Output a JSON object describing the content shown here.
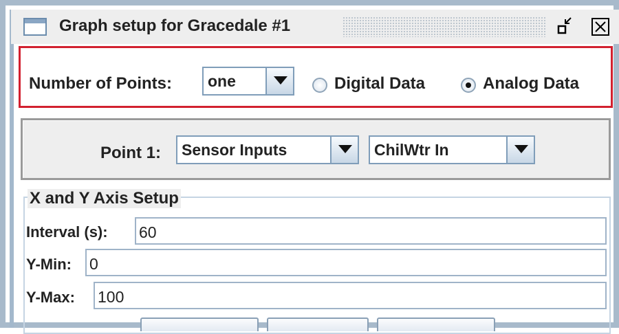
{
  "window": {
    "title": "Graph setup for Gracedale #1"
  },
  "points_row": {
    "label": "Number of Points:",
    "count_value": "one",
    "radio_digital": "Digital Data",
    "radio_analog": "Analog Data",
    "selected": "Analog Data"
  },
  "point1": {
    "label": "Point 1:",
    "category_value": "Sensor Inputs",
    "sensor_value": "ChilWtr In"
  },
  "axis": {
    "legend": "X and Y Axis Setup",
    "interval_label": "Interval (s):",
    "interval_value": "60",
    "ymin_label": "Y-Min:",
    "ymin_value": "0",
    "ymax_label": "Y-Max:",
    "ymax_value": "100"
  },
  "colors": {
    "highlight": "#d2202f",
    "frame": "#a8bacb"
  }
}
